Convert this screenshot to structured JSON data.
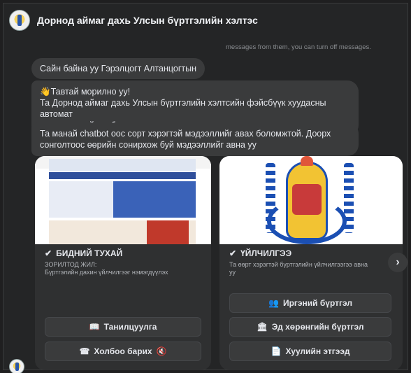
{
  "header": {
    "title": "Дорнод аймаг дахь Улсын бүртгэлийн хэлтэс",
    "logo": "agency-emblem-avatar"
  },
  "note": "messages from them, you can turn off messages.",
  "messages": [
    {
      "text": "Сайн байна уу Гэрэлцогт Алтанцогтын"
    },
    {
      "line1": "Тавтай морилно уу!",
      "line2": "Та Дорнод аймаг дахь Улсын бүртгэлийн хэлтсийн фэйсбүүк хуудасны автомат",
      "line3": "хариулагчтай холбогдлоо."
    },
    {
      "line1": "Та манай chatbot оос сорт хэрэгтэй мэдээллийг авах боломжтой. Доорх",
      "line2": "сонголтоос өөрийн сонирхож буй мэдээллийг авна уу"
    }
  ],
  "cards": [
    {
      "title": "БИДНИЙ ТУХАЙ",
      "subtitle_line1": "ЗОРИЛТОД ЖИЛ:",
      "subtitle_line2": "Бүртгэлийн дахин үйлчилгээг нэмэгдүүлэх",
      "buttons": [
        {
          "icon": "book-icon",
          "glyph": "📖",
          "label": "Танилцуулга"
        },
        {
          "icon": "phone-icon",
          "glyph": "☎",
          "label": "Холбоо барих",
          "suffix": "🔇"
        }
      ]
    },
    {
      "title": "ҮЙЛЧИЛГЭЭ",
      "subtitle_line1": "Та өөрт хэрэгтэй бүртгэлийн үйлчилгээгээ авна",
      "subtitle_line2": "уу",
      "buttons": [
        {
          "icon": "people-icon",
          "glyph": "👥",
          "label": "Иргэний бүртгэл"
        },
        {
          "icon": "building-icon",
          "glyph": "🏛",
          "label": "Эд хөрөнгийн бүртгэл"
        },
        {
          "icon": "document-icon",
          "glyph": "📄",
          "label": "Хуулийн этгээд"
        }
      ]
    }
  ],
  "carousel_next": "›",
  "checkmark": "✔",
  "wave": "👋"
}
